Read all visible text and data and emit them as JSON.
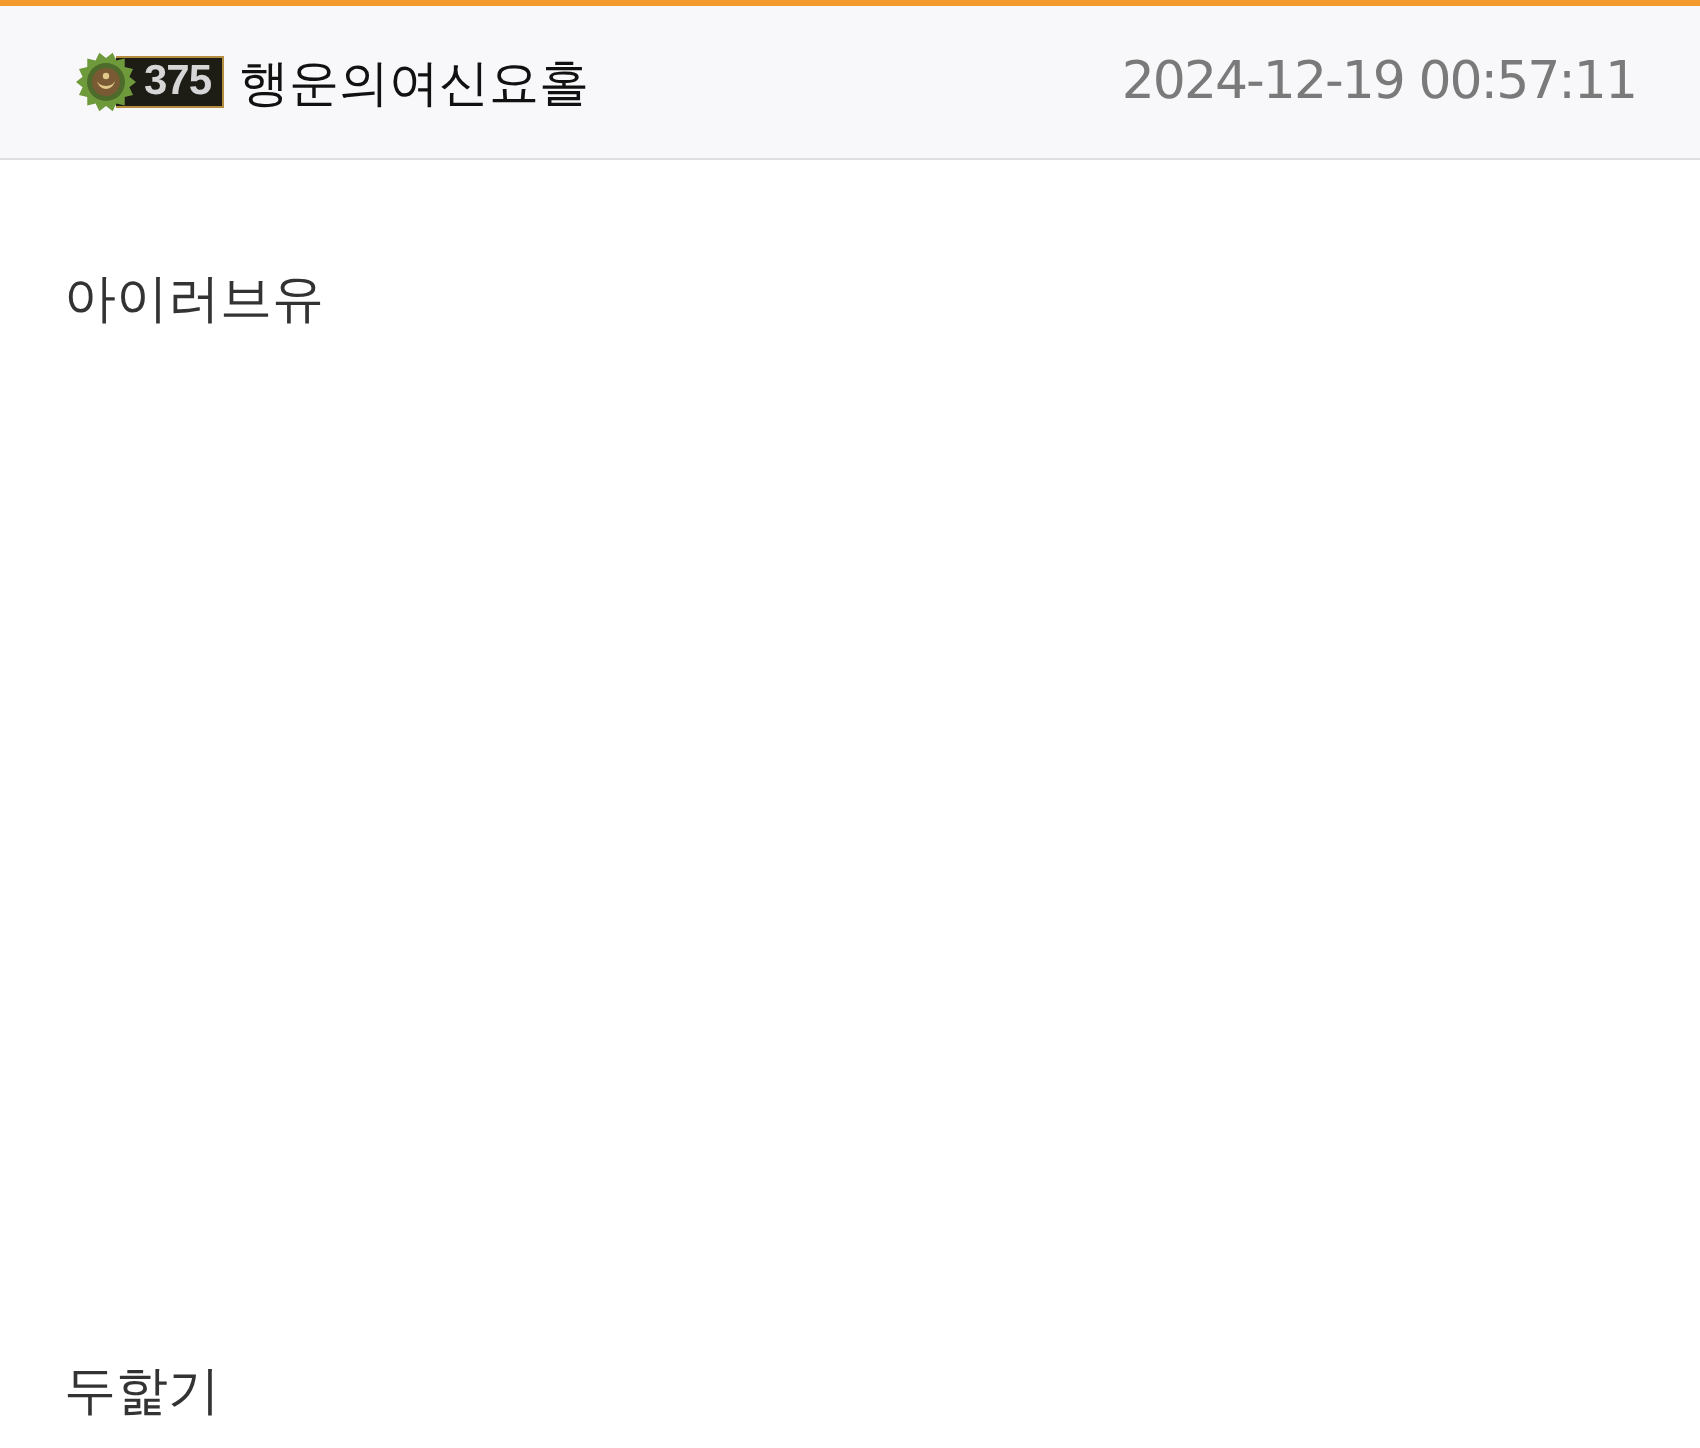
{
  "post_header": {
    "level": "375",
    "author": "행운의여신요홀",
    "timestamp": "2024-12-19 00:57:11"
  },
  "post_body": {
    "paragraphs": [
      "아이러브유",
      "두핥기"
    ]
  }
}
